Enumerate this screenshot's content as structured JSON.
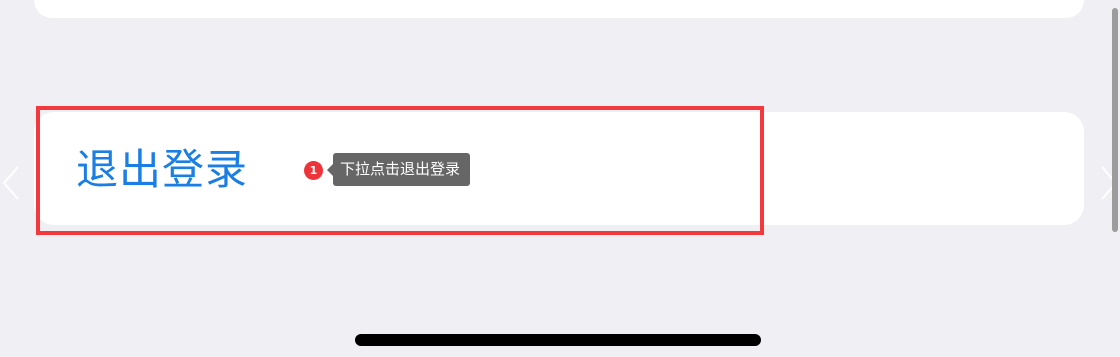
{
  "logout": {
    "label": "退出登录"
  },
  "annotation": {
    "step_number": "1",
    "tooltip_text": "下拉点击退出登录"
  },
  "icons": {
    "left_arrow": "chevron-left-icon",
    "right_arrow": "chevron-right-icon"
  },
  "colors": {
    "background": "#f0eff4",
    "card": "#ffffff",
    "logout_text": "#1a7ee4",
    "highlight_border": "#f2393d",
    "badge": "#ee3438",
    "tooltip_bg": "#666666"
  }
}
